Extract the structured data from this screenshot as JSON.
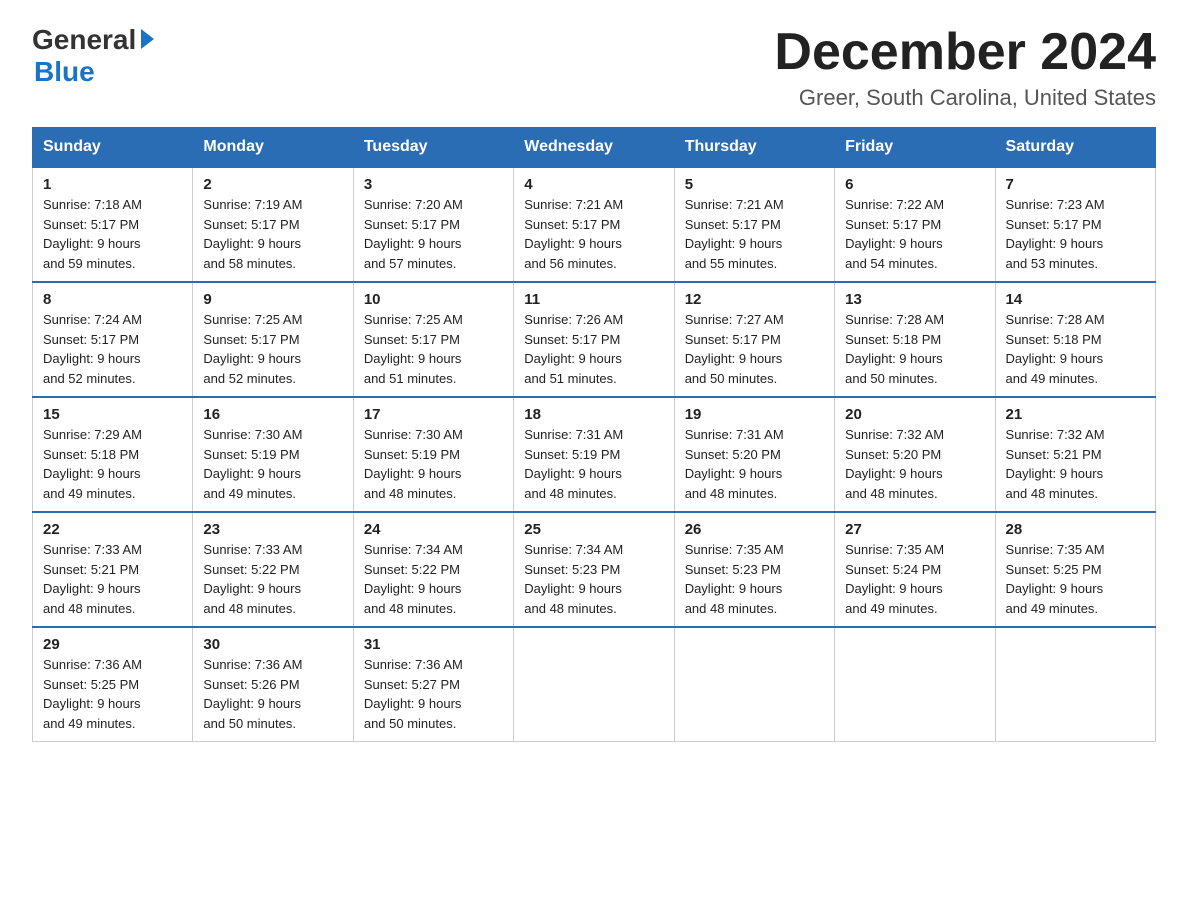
{
  "logo": {
    "general": "General",
    "blue": "Blue"
  },
  "title": "December 2024",
  "location": "Greer, South Carolina, United States",
  "weekdays": [
    "Sunday",
    "Monday",
    "Tuesday",
    "Wednesday",
    "Thursday",
    "Friday",
    "Saturday"
  ],
  "weeks": [
    [
      {
        "day": "1",
        "sunrise": "7:18 AM",
        "sunset": "5:17 PM",
        "daylight": "9 hours and 59 minutes."
      },
      {
        "day": "2",
        "sunrise": "7:19 AM",
        "sunset": "5:17 PM",
        "daylight": "9 hours and 58 minutes."
      },
      {
        "day": "3",
        "sunrise": "7:20 AM",
        "sunset": "5:17 PM",
        "daylight": "9 hours and 57 minutes."
      },
      {
        "day": "4",
        "sunrise": "7:21 AM",
        "sunset": "5:17 PM",
        "daylight": "9 hours and 56 minutes."
      },
      {
        "day": "5",
        "sunrise": "7:21 AM",
        "sunset": "5:17 PM",
        "daylight": "9 hours and 55 minutes."
      },
      {
        "day": "6",
        "sunrise": "7:22 AM",
        "sunset": "5:17 PM",
        "daylight": "9 hours and 54 minutes."
      },
      {
        "day": "7",
        "sunrise": "7:23 AM",
        "sunset": "5:17 PM",
        "daylight": "9 hours and 53 minutes."
      }
    ],
    [
      {
        "day": "8",
        "sunrise": "7:24 AM",
        "sunset": "5:17 PM",
        "daylight": "9 hours and 52 minutes."
      },
      {
        "day": "9",
        "sunrise": "7:25 AM",
        "sunset": "5:17 PM",
        "daylight": "9 hours and 52 minutes."
      },
      {
        "day": "10",
        "sunrise": "7:25 AM",
        "sunset": "5:17 PM",
        "daylight": "9 hours and 51 minutes."
      },
      {
        "day": "11",
        "sunrise": "7:26 AM",
        "sunset": "5:17 PM",
        "daylight": "9 hours and 51 minutes."
      },
      {
        "day": "12",
        "sunrise": "7:27 AM",
        "sunset": "5:17 PM",
        "daylight": "9 hours and 50 minutes."
      },
      {
        "day": "13",
        "sunrise": "7:28 AM",
        "sunset": "5:18 PM",
        "daylight": "9 hours and 50 minutes."
      },
      {
        "day": "14",
        "sunrise": "7:28 AM",
        "sunset": "5:18 PM",
        "daylight": "9 hours and 49 minutes."
      }
    ],
    [
      {
        "day": "15",
        "sunrise": "7:29 AM",
        "sunset": "5:18 PM",
        "daylight": "9 hours and 49 minutes."
      },
      {
        "day": "16",
        "sunrise": "7:30 AM",
        "sunset": "5:19 PM",
        "daylight": "9 hours and 49 minutes."
      },
      {
        "day": "17",
        "sunrise": "7:30 AM",
        "sunset": "5:19 PM",
        "daylight": "9 hours and 48 minutes."
      },
      {
        "day": "18",
        "sunrise": "7:31 AM",
        "sunset": "5:19 PM",
        "daylight": "9 hours and 48 minutes."
      },
      {
        "day": "19",
        "sunrise": "7:31 AM",
        "sunset": "5:20 PM",
        "daylight": "9 hours and 48 minutes."
      },
      {
        "day": "20",
        "sunrise": "7:32 AM",
        "sunset": "5:20 PM",
        "daylight": "9 hours and 48 minutes."
      },
      {
        "day": "21",
        "sunrise": "7:32 AM",
        "sunset": "5:21 PM",
        "daylight": "9 hours and 48 minutes."
      }
    ],
    [
      {
        "day": "22",
        "sunrise": "7:33 AM",
        "sunset": "5:21 PM",
        "daylight": "9 hours and 48 minutes."
      },
      {
        "day": "23",
        "sunrise": "7:33 AM",
        "sunset": "5:22 PM",
        "daylight": "9 hours and 48 minutes."
      },
      {
        "day": "24",
        "sunrise": "7:34 AM",
        "sunset": "5:22 PM",
        "daylight": "9 hours and 48 minutes."
      },
      {
        "day": "25",
        "sunrise": "7:34 AM",
        "sunset": "5:23 PM",
        "daylight": "9 hours and 48 minutes."
      },
      {
        "day": "26",
        "sunrise": "7:35 AM",
        "sunset": "5:23 PM",
        "daylight": "9 hours and 48 minutes."
      },
      {
        "day": "27",
        "sunrise": "7:35 AM",
        "sunset": "5:24 PM",
        "daylight": "9 hours and 49 minutes."
      },
      {
        "day": "28",
        "sunrise": "7:35 AM",
        "sunset": "5:25 PM",
        "daylight": "9 hours and 49 minutes."
      }
    ],
    [
      {
        "day": "29",
        "sunrise": "7:36 AM",
        "sunset": "5:25 PM",
        "daylight": "9 hours and 49 minutes."
      },
      {
        "day": "30",
        "sunrise": "7:36 AM",
        "sunset": "5:26 PM",
        "daylight": "9 hours and 50 minutes."
      },
      {
        "day": "31",
        "sunrise": "7:36 AM",
        "sunset": "5:27 PM",
        "daylight": "9 hours and 50 minutes."
      },
      null,
      null,
      null,
      null
    ]
  ],
  "labels": {
    "sunrise": "Sunrise:",
    "sunset": "Sunset:",
    "daylight": "Daylight:"
  }
}
